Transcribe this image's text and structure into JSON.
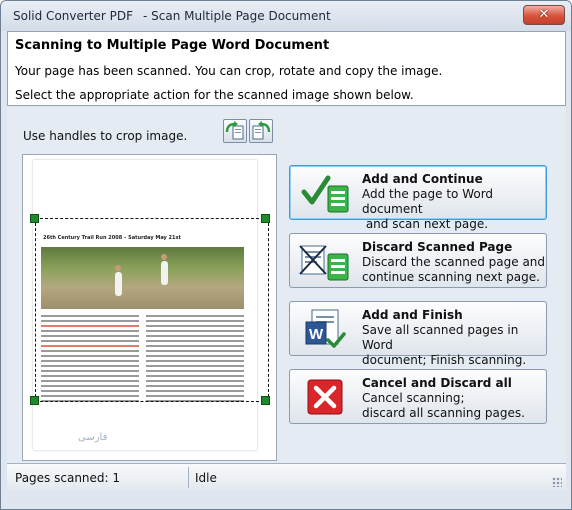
{
  "window": {
    "app_name": "Solid Converter PDF",
    "doc_title": "- Scan Multiple Page Document",
    "close_glyph": "✕"
  },
  "header": {
    "title": "Scanning to Multiple Page Word Document",
    "line1": "Your page has been scanned. You can crop, rotate and copy the image.",
    "line2": "Select the appropriate action for the scanned image shown below."
  },
  "preview": {
    "crop_label": "Use handles to crop image.",
    "doc_heading": "26th Century Trail Run 2008 – Saturday May 21st",
    "watermark": "فارسی"
  },
  "actions": [
    {
      "title": "Add and Continue",
      "line1": "Add the page to Word document",
      "line2": " and scan next page.",
      "icon": "check-add-icon"
    },
    {
      "title": "Discard Scanned Page",
      "line1": "Discard the scanned page and",
      "line2": "continue scanning next page.",
      "icon": "scanner-discard-icon"
    },
    {
      "title": "Add and Finish",
      "line1": "Save all scanned pages in Word",
      "line2": "document; Finish scanning.",
      "icon": "word-finish-icon"
    },
    {
      "title": "Cancel and Discard all",
      "line1": "Cancel scanning;",
      "line2": "discard all scanning pages.",
      "icon": "cancel-x-icon"
    }
  ],
  "status": {
    "pages_scanned": "Pages scanned: 1",
    "state": "Idle"
  },
  "colors": {
    "accent": "#3c9bd8",
    "handle": "#1f8a2c",
    "cancel": "#d9262a"
  }
}
